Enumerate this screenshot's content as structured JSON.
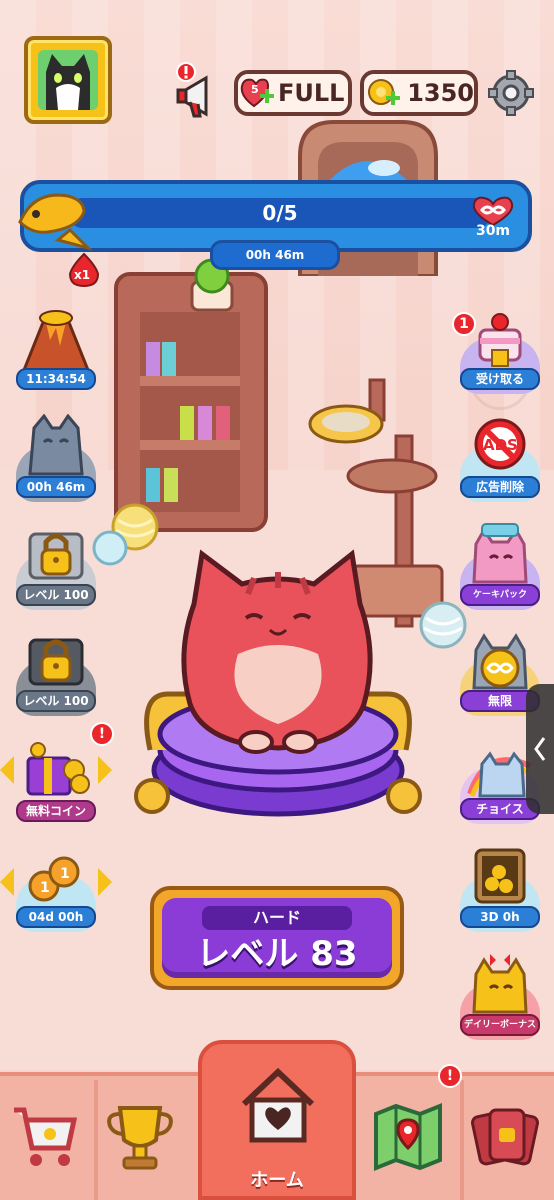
{
  "hud": {
    "lives": {
      "count": "5",
      "status": "FULL"
    },
    "coins": "1350"
  },
  "progress": {
    "value": "0/5",
    "fraction": 0.0,
    "timer": "00h 46m",
    "infinite_time": "30m",
    "multiplier": "x1"
  },
  "left_buttons": [
    {
      "icon": "volcano-icon",
      "label": "11:34:54"
    },
    {
      "icon": "stone-cat-statue-icon",
      "label": "00h 46m"
    },
    {
      "icon": "locked-silver-chest-icon",
      "label": "レベル 100"
    },
    {
      "icon": "locked-dark-chest-icon",
      "label": "レベル 100"
    },
    {
      "icon": "free-coins-gift-icon",
      "label": "無料コイン",
      "badge": "!"
    },
    {
      "icon": "coin-bundle-icon",
      "label": "04d 00h"
    }
  ],
  "right_buttons": [
    {
      "icon": "cake-gift-icon",
      "label": "受け取る",
      "badge": "1"
    },
    {
      "icon": "no-ads-icon",
      "label": "広告削除",
      "inner_text": "ADS"
    },
    {
      "icon": "cake-pack-cat-icon",
      "label": "ケーキパック"
    },
    {
      "icon": "infinite-gold-cat-icon",
      "label": "無限"
    },
    {
      "icon": "choice-cat-icon",
      "label": "チョイス"
    },
    {
      "icon": "gold-vault-icon",
      "label": "3D 0h"
    },
    {
      "icon": "daily-bonus-cat-icon",
      "label": "デイリーボーナス"
    }
  ],
  "level": {
    "difficulty": "ハード",
    "label": "レベル 83"
  },
  "nav": {
    "home_label": "ホーム",
    "map_badge": "!"
  },
  "notify_badge": "!",
  "colors": {
    "accent_purple": "#8b3cd6",
    "accent_blue": "#2a8fe0",
    "nav_red": "#f26f5e",
    "cat_red": "#e9525a"
  }
}
